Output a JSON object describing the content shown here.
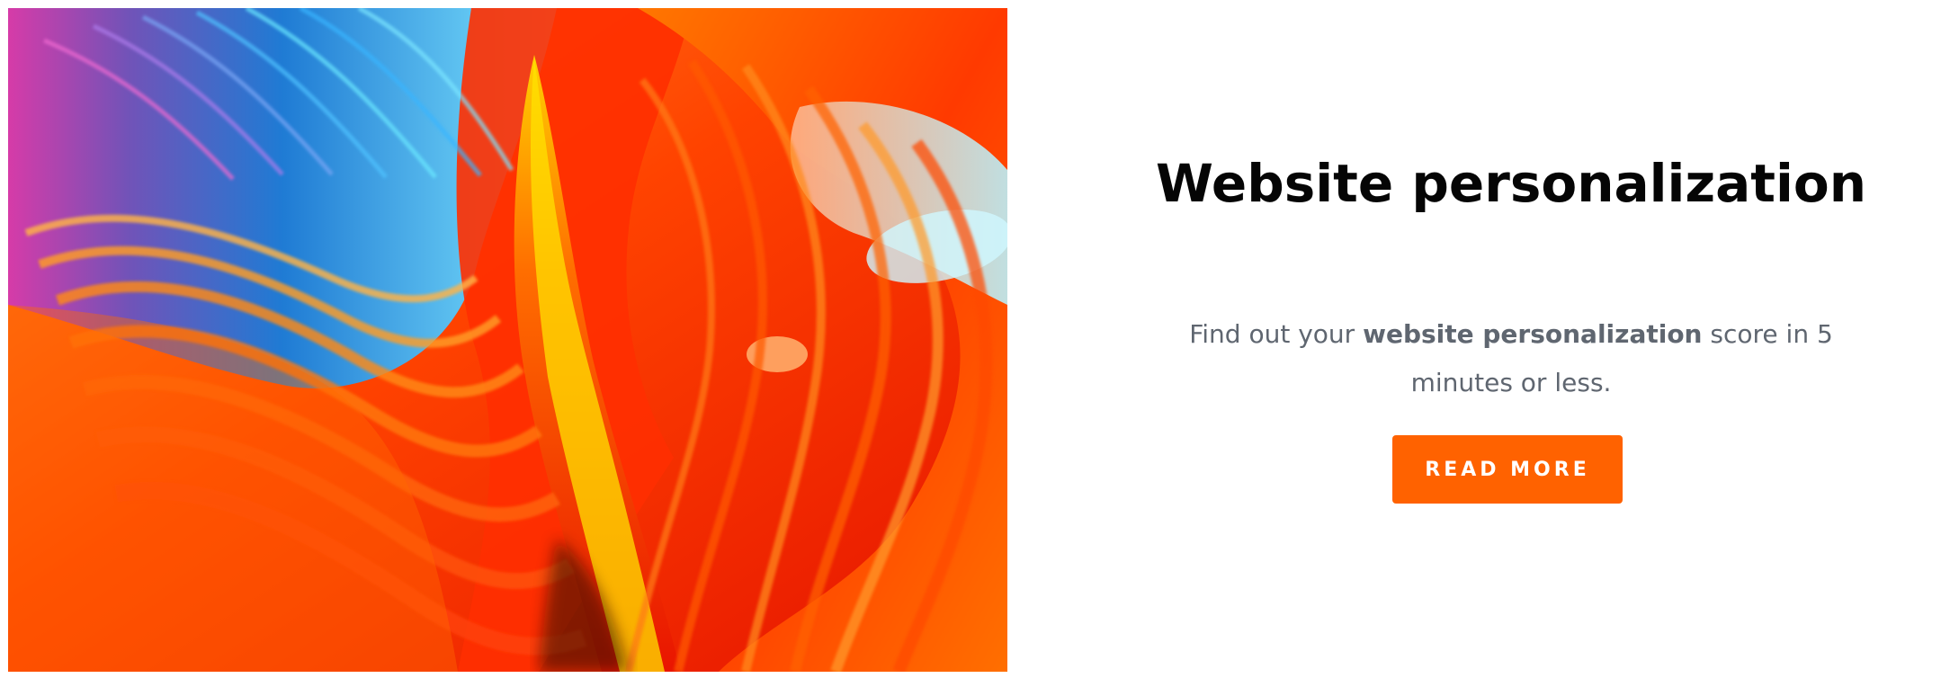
{
  "hero": {
    "title": "Website personalization",
    "description_prefix": "Find out your ",
    "description_bold": "website personalization",
    "description_suffix": " score in 5 minutes or less.",
    "button_label": "READ MORE"
  },
  "colors": {
    "accent": "#ff6200",
    "title": "#050505",
    "body_text": "#5f6670"
  },
  "image": {
    "description_icon": "abstract-wave-art-image"
  }
}
